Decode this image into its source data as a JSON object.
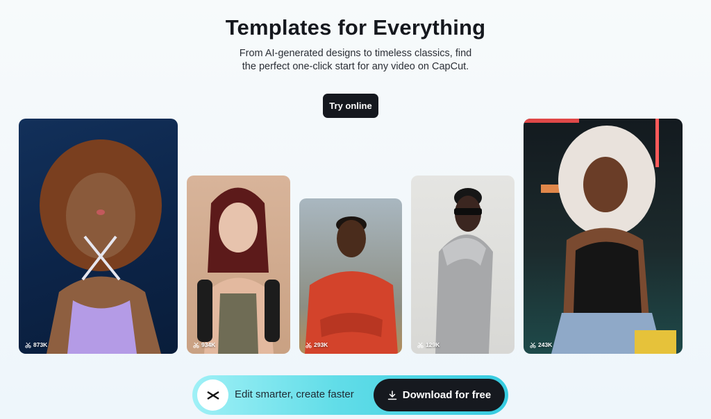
{
  "hero": {
    "title": "Templates for Everything",
    "subtitle": "From AI-generated designs to timeless classics, find the perfect one-click start for any video on CapCut.",
    "cta_label": "Try online"
  },
  "templates": [
    {
      "usage": "873K"
    },
    {
      "usage": "934K"
    },
    {
      "usage": "293K"
    },
    {
      "usage": "129K"
    },
    {
      "usage": "243K"
    }
  ],
  "promo": {
    "text": "Edit smarter, create faster",
    "button_label": "Download for free"
  },
  "icons": {
    "usage": "scissors-icon",
    "logo": "capcut-logo-icon",
    "download": "download-icon"
  },
  "colors": {
    "primary_dark": "#15181e",
    "promo_start": "#9ff0f6",
    "promo_end": "#36cbe0"
  }
}
